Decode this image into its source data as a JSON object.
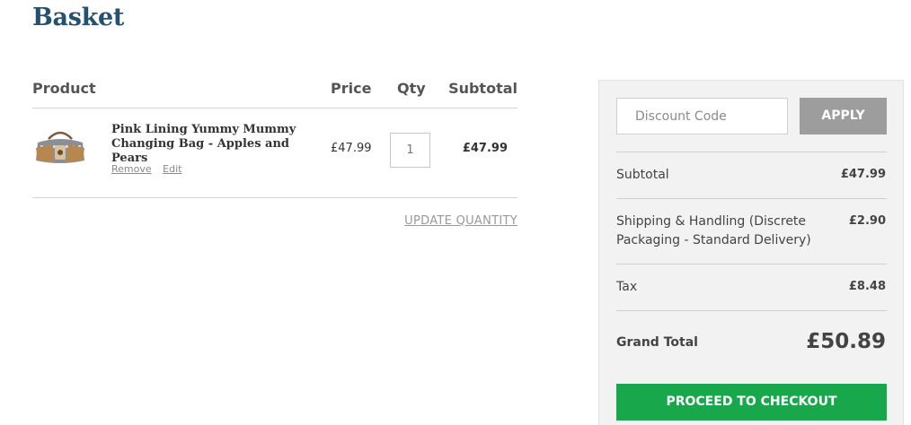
{
  "page": {
    "title": "Basket"
  },
  "cart": {
    "headers": {
      "product": "Product",
      "price": "Price",
      "qty": "Qty",
      "subtotal": "Subtotal"
    },
    "items": [
      {
        "name": "Pink Lining Yummy Mummy Changing Bag - Apples and Pears",
        "price": "£47.99",
        "qty": "1",
        "subtotal": "£47.99",
        "remove_label": "Remove",
        "edit_label": "Edit",
        "image_icon": "changing-bag-thumbnail"
      }
    ],
    "update_label": "UPDATE QUANTITY"
  },
  "summary": {
    "discount": {
      "placeholder": "Discount Code",
      "value": "",
      "apply_label": "APPLY"
    },
    "rows": [
      {
        "label": "Subtotal",
        "value": "£47.99"
      },
      {
        "label": "Shipping & Handling (Discrete Packaging - Standard Delivery)",
        "value": "£2.90"
      },
      {
        "label": "Tax",
        "value": "£8.48"
      }
    ],
    "grand_total": {
      "label": "Grand Total",
      "value": "£50.89"
    },
    "checkout_label": "PROCEED TO CHECKOUT"
  },
  "colors": {
    "title": "#25506e",
    "apply_button": "#9d9d9d",
    "checkout_button": "#18a84b",
    "panel_background": "#f2f2f2"
  }
}
